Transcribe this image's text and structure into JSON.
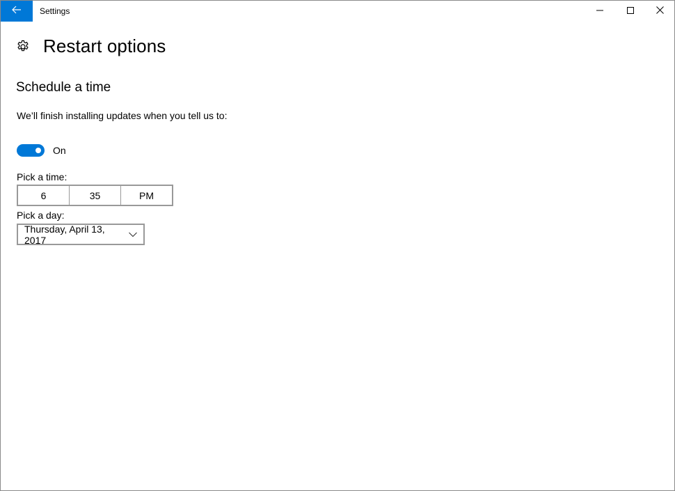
{
  "window": {
    "title": "Settings"
  },
  "header": {
    "page_title": "Restart options"
  },
  "section": {
    "title": "Schedule a time",
    "description": "We’ll finish installing updates when you tell us to:"
  },
  "toggle": {
    "state_label": "On",
    "is_on": true
  },
  "time_picker": {
    "label": "Pick a time:",
    "hour": "6",
    "minute": "35",
    "period": "PM"
  },
  "day_picker": {
    "label": "Pick a day:",
    "value": "Thursday, April 13, 2017"
  },
  "colors": {
    "accent": "#0078d7",
    "border": "#999999"
  },
  "icons": {
    "back": "back-arrow-icon",
    "minimize": "minimize-icon",
    "maximize": "maximize-icon",
    "close": "close-icon",
    "settings": "gear-icon",
    "dropdown": "chevron-down-icon"
  }
}
